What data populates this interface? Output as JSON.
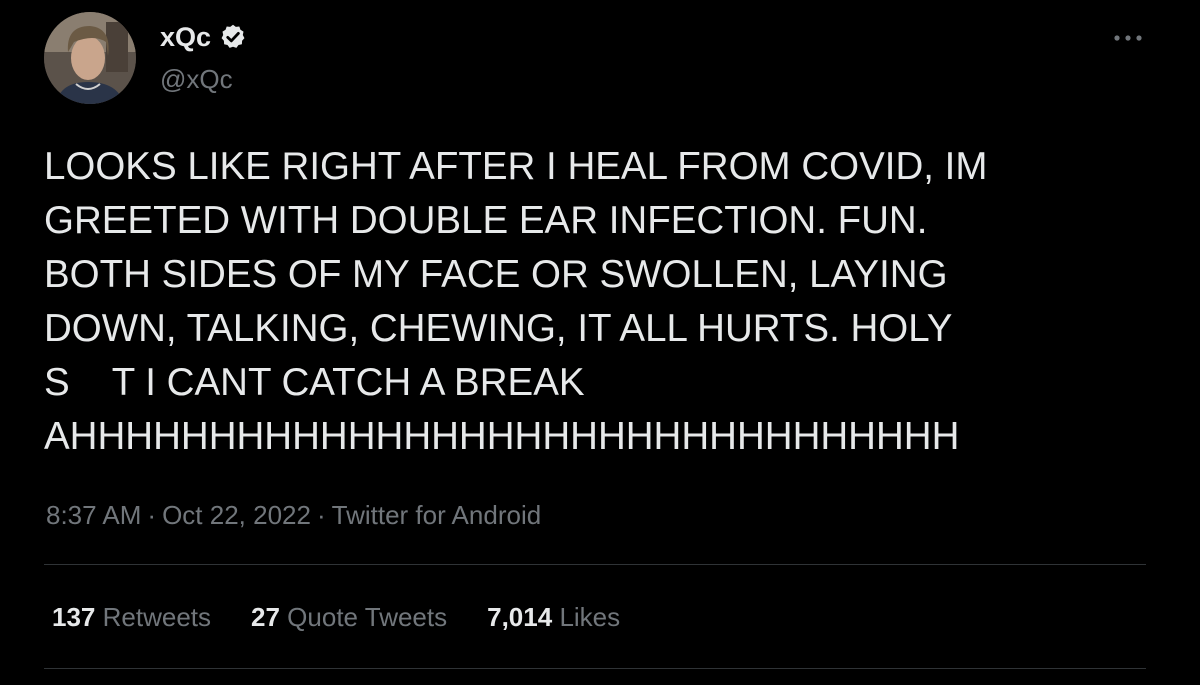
{
  "author": {
    "display_name": "xQc",
    "handle": "@xQc",
    "verified": true
  },
  "tweet": {
    "text_lines": [
      "LOOKS LIKE RIGHT AFTER I HEAL FROM COVID, IM",
      "GREETED WITH DOUBLE EAR INFECTION. FUN.",
      "BOTH SIDES OF MY FACE OR SWOLLEN, LAYING",
      "DOWN, TALKING, CHEWING, IT ALL HURTS. HOLY",
      "S    T I CANT CATCH A BREAK",
      "AHHHHHHHHHHHHHHHHHHHHHHHHHHHHHHHH"
    ],
    "time": "8:37 AM",
    "date": "Oct 22, 2022",
    "source": "Twitter for Android",
    "separator": "·"
  },
  "stats": {
    "retweets": {
      "count": "137",
      "label": "Retweets"
    },
    "quotes": {
      "count": "27",
      "label": "Quote Tweets"
    },
    "likes": {
      "count": "7,014",
      "label": "Likes"
    }
  },
  "icons": {
    "verified": "verified-badge-icon",
    "more": "more-dots-icon"
  },
  "colors": {
    "background": "#000000",
    "text": "#e7e9ea",
    "secondary": "#71767b",
    "divider": "#2f3336"
  }
}
